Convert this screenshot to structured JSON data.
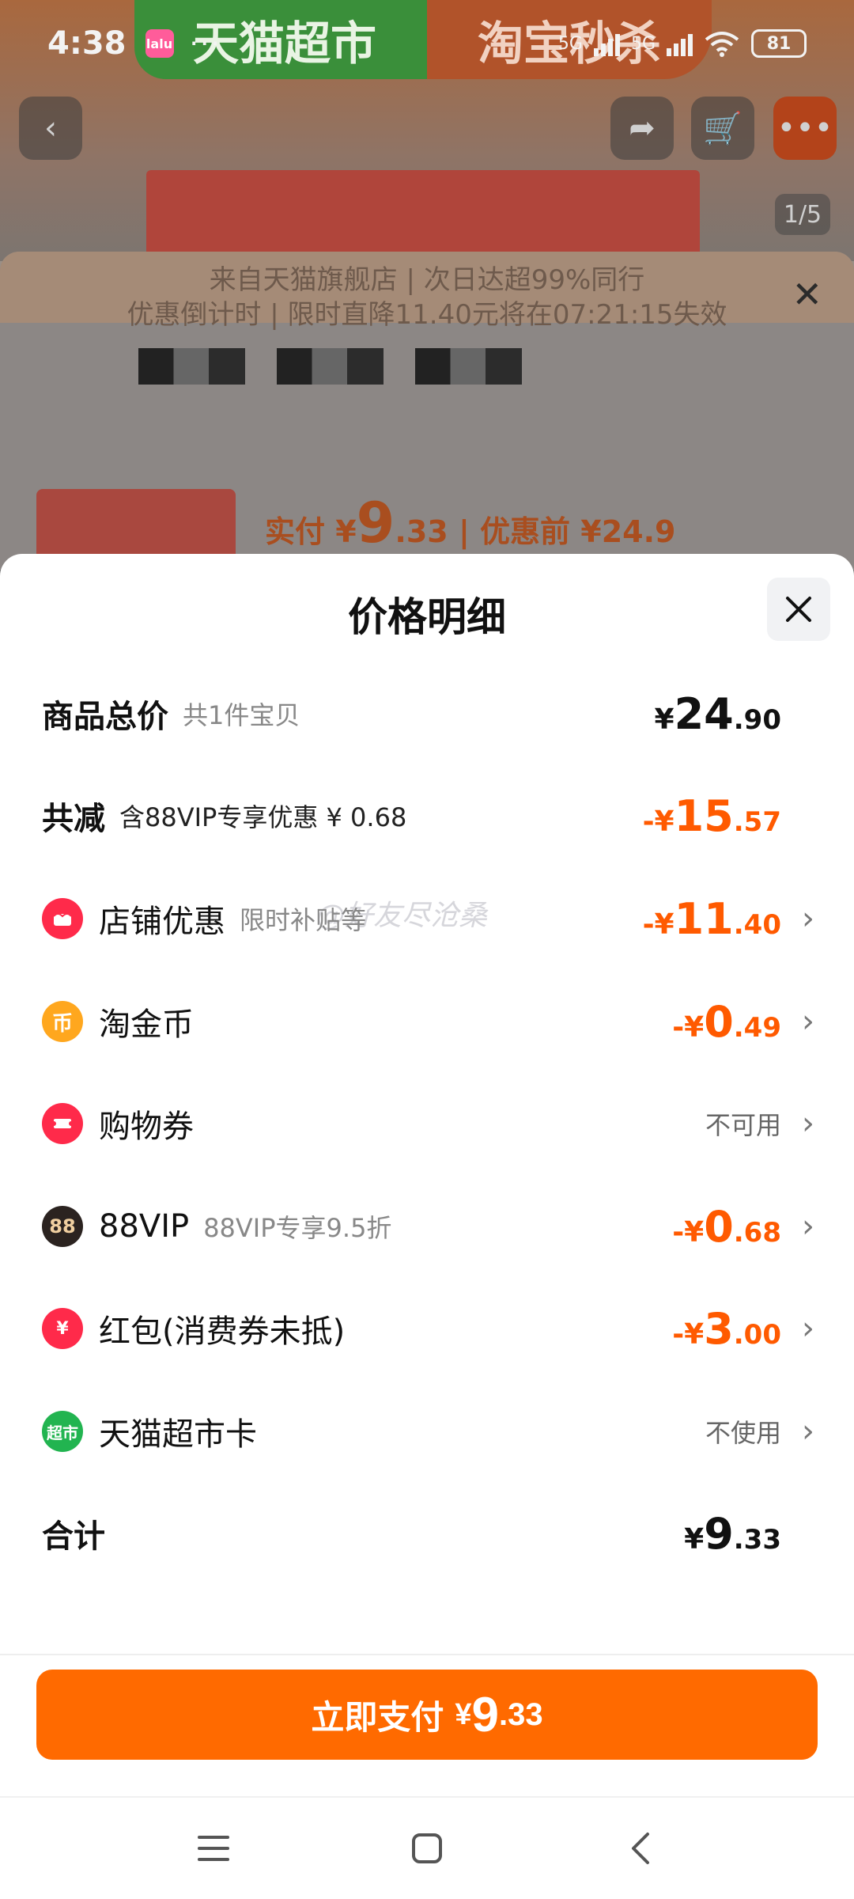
{
  "status_bar": {
    "time": "4:38",
    "app_icon_text": "lalu",
    "dots": "···",
    "net1": "5G",
    "net2": "5G",
    "battery": "81"
  },
  "background": {
    "tag_green": "天猫超市",
    "tag_orange": "淘宝秒杀",
    "counter": "1/5",
    "notice_line1": "来自天猫旗舰店 | 次日达超99%同行",
    "notice_line2": "优惠倒计时 | 限时直降11.40元将在07:21:15失效",
    "price_prefix": "实付 ¥",
    "price_int": "9",
    "price_dec": ".33",
    "price_before": "| 优惠前 ¥24.9"
  },
  "sheet": {
    "title": "价格明细",
    "watermark": "@好友尽沧桑",
    "rows": [
      {
        "label": "商品总价",
        "sub": "共1件宝贝",
        "yen": "¥",
        "int": "24",
        "dec": ".90"
      },
      {
        "label": "共减",
        "sub": "含88VIP专享优惠 ¥ 0.68",
        "yen": "-¥",
        "int": "15",
        "dec": ".57"
      },
      {
        "label": "店铺优惠",
        "sub": "限时补贴等",
        "yen": "-¥",
        "int": "11",
        "dec": ".40"
      },
      {
        "label": "淘金币",
        "sub": "",
        "yen": "-¥",
        "int": "0",
        "dec": ".49"
      },
      {
        "label": "购物券",
        "sub": "",
        "status": "不可用"
      },
      {
        "label": "88VIP",
        "sub": "88VIP专享9.5折",
        "yen": "-¥",
        "int": "0",
        "dec": ".68"
      },
      {
        "label": "红包(消费券未抵)",
        "sub": "",
        "yen": "-¥",
        "int": "3",
        "dec": ".00"
      },
      {
        "label": "天猫超市卡",
        "sub": "",
        "status": "不使用"
      },
      {
        "label": "合计",
        "sub": "",
        "yen": "¥",
        "int": "9",
        "dec": ".33"
      }
    ],
    "icons": {
      "coin": "币",
      "vip": "88",
      "redpack": "¥",
      "market": "超市"
    }
  },
  "pay": {
    "label": "立即支付",
    "yen": "¥",
    "int": "9",
    "dec": ".33"
  },
  "colors": {
    "accent_orange": "#ff6a00",
    "discount_orange": "#ff5a00",
    "red_icon": "#ff2a4a"
  }
}
